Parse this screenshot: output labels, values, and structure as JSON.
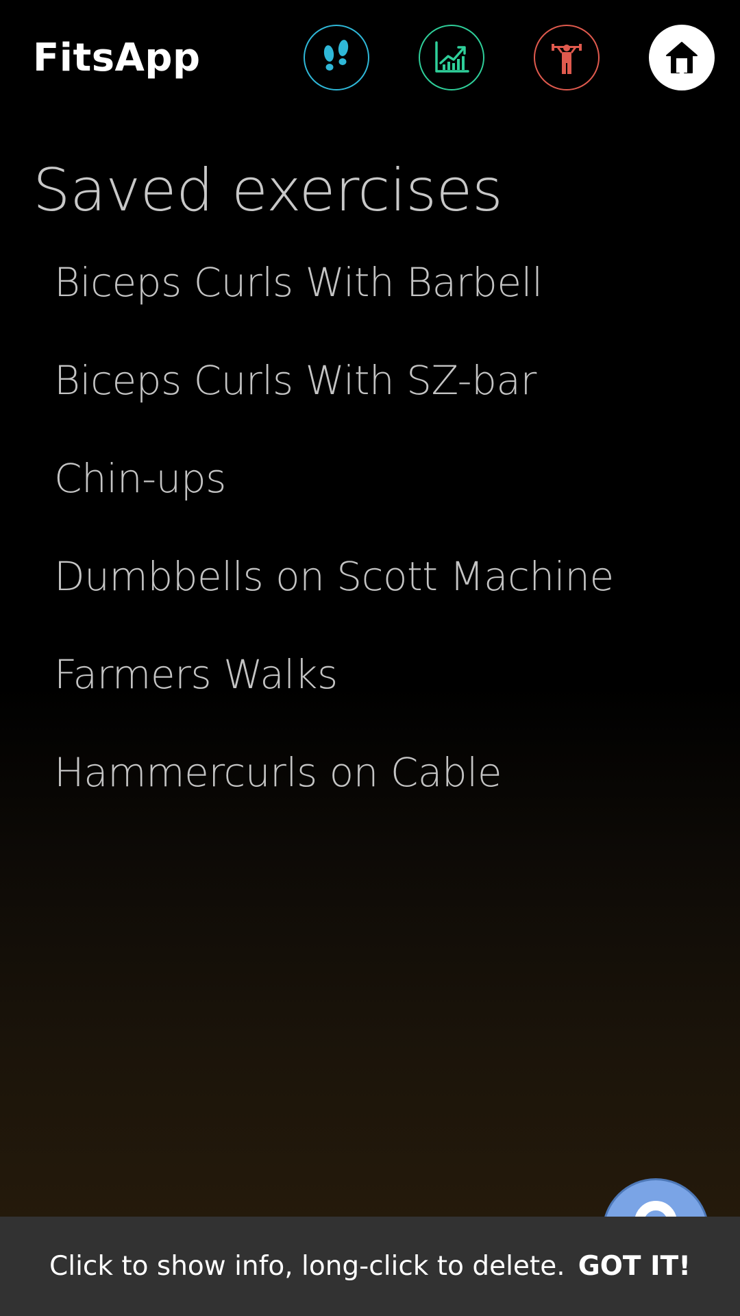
{
  "app": {
    "title": "FitsApp"
  },
  "nav": {
    "buttons": [
      {
        "name": "steps",
        "icon": "footsteps-icon",
        "color": "#2fb8d8"
      },
      {
        "name": "stats",
        "icon": "chart-trend-icon",
        "color": "#2fcf9a"
      },
      {
        "name": "workout",
        "icon": "weightlifter-icon",
        "color": "#e05a4e"
      },
      {
        "name": "home",
        "icon": "home-icon",
        "color": "#ffffff"
      }
    ]
  },
  "main": {
    "heading": "Saved exercises",
    "exercises": [
      "Biceps Curls With Barbell",
      "Biceps Curls With SZ-bar",
      "Chin-ups",
      "Dumbbells on Scott Machine",
      "Farmers Walks",
      "Hammercurls on Cable"
    ]
  },
  "fab": {
    "icon": "help-icon",
    "color": "#7aa4e6"
  },
  "snackbar": {
    "message": "Click to show info, long-click to delete.",
    "action": "GOT IT!"
  }
}
